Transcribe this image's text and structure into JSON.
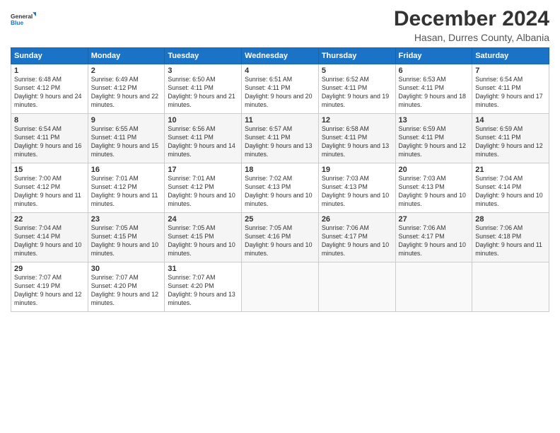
{
  "logo": {
    "line1": "General",
    "line2": "Blue"
  },
  "title": "December 2024",
  "subtitle": "Hasan, Durres County, Albania",
  "days_header": [
    "Sunday",
    "Monday",
    "Tuesday",
    "Wednesday",
    "Thursday",
    "Friday",
    "Saturday"
  ],
  "weeks": [
    [
      {
        "day": "1",
        "sunrise": "6:48 AM",
        "sunset": "4:12 PM",
        "daylight": "9 hours and 24 minutes."
      },
      {
        "day": "2",
        "sunrise": "6:49 AM",
        "sunset": "4:12 PM",
        "daylight": "9 hours and 22 minutes."
      },
      {
        "day": "3",
        "sunrise": "6:50 AM",
        "sunset": "4:11 PM",
        "daylight": "9 hours and 21 minutes."
      },
      {
        "day": "4",
        "sunrise": "6:51 AM",
        "sunset": "4:11 PM",
        "daylight": "9 hours and 20 minutes."
      },
      {
        "day": "5",
        "sunrise": "6:52 AM",
        "sunset": "4:11 PM",
        "daylight": "9 hours and 19 minutes."
      },
      {
        "day": "6",
        "sunrise": "6:53 AM",
        "sunset": "4:11 PM",
        "daylight": "9 hours and 18 minutes."
      },
      {
        "day": "7",
        "sunrise": "6:54 AM",
        "sunset": "4:11 PM",
        "daylight": "9 hours and 17 minutes."
      }
    ],
    [
      {
        "day": "8",
        "sunrise": "6:54 AM",
        "sunset": "4:11 PM",
        "daylight": "9 hours and 16 minutes."
      },
      {
        "day": "9",
        "sunrise": "6:55 AM",
        "sunset": "4:11 PM",
        "daylight": "9 hours and 15 minutes."
      },
      {
        "day": "10",
        "sunrise": "6:56 AM",
        "sunset": "4:11 PM",
        "daylight": "9 hours and 14 minutes."
      },
      {
        "day": "11",
        "sunrise": "6:57 AM",
        "sunset": "4:11 PM",
        "daylight": "9 hours and 13 minutes."
      },
      {
        "day": "12",
        "sunrise": "6:58 AM",
        "sunset": "4:11 PM",
        "daylight": "9 hours and 13 minutes."
      },
      {
        "day": "13",
        "sunrise": "6:59 AM",
        "sunset": "4:11 PM",
        "daylight": "9 hours and 12 minutes."
      },
      {
        "day": "14",
        "sunrise": "6:59 AM",
        "sunset": "4:11 PM",
        "daylight": "9 hours and 12 minutes."
      }
    ],
    [
      {
        "day": "15",
        "sunrise": "7:00 AM",
        "sunset": "4:12 PM",
        "daylight": "9 hours and 11 minutes."
      },
      {
        "day": "16",
        "sunrise": "7:01 AM",
        "sunset": "4:12 PM",
        "daylight": "9 hours and 11 minutes."
      },
      {
        "day": "17",
        "sunrise": "7:01 AM",
        "sunset": "4:12 PM",
        "daylight": "9 hours and 10 minutes."
      },
      {
        "day": "18",
        "sunrise": "7:02 AM",
        "sunset": "4:13 PM",
        "daylight": "9 hours and 10 minutes."
      },
      {
        "day": "19",
        "sunrise": "7:03 AM",
        "sunset": "4:13 PM",
        "daylight": "9 hours and 10 minutes."
      },
      {
        "day": "20",
        "sunrise": "7:03 AM",
        "sunset": "4:13 PM",
        "daylight": "9 hours and 10 minutes."
      },
      {
        "day": "21",
        "sunrise": "7:04 AM",
        "sunset": "4:14 PM",
        "daylight": "9 hours and 10 minutes."
      }
    ],
    [
      {
        "day": "22",
        "sunrise": "7:04 AM",
        "sunset": "4:14 PM",
        "daylight": "9 hours and 10 minutes."
      },
      {
        "day": "23",
        "sunrise": "7:05 AM",
        "sunset": "4:15 PM",
        "daylight": "9 hours and 10 minutes."
      },
      {
        "day": "24",
        "sunrise": "7:05 AM",
        "sunset": "4:15 PM",
        "daylight": "9 hours and 10 minutes."
      },
      {
        "day": "25",
        "sunrise": "7:05 AM",
        "sunset": "4:16 PM",
        "daylight": "9 hours and 10 minutes."
      },
      {
        "day": "26",
        "sunrise": "7:06 AM",
        "sunset": "4:17 PM",
        "daylight": "9 hours and 10 minutes."
      },
      {
        "day": "27",
        "sunrise": "7:06 AM",
        "sunset": "4:17 PM",
        "daylight": "9 hours and 10 minutes."
      },
      {
        "day": "28",
        "sunrise": "7:06 AM",
        "sunset": "4:18 PM",
        "daylight": "9 hours and 11 minutes."
      }
    ],
    [
      {
        "day": "29",
        "sunrise": "7:07 AM",
        "sunset": "4:19 PM",
        "daylight": "9 hours and 12 minutes."
      },
      {
        "day": "30",
        "sunrise": "7:07 AM",
        "sunset": "4:20 PM",
        "daylight": "9 hours and 12 minutes."
      },
      {
        "day": "31",
        "sunrise": "7:07 AM",
        "sunset": "4:20 PM",
        "daylight": "9 hours and 13 minutes."
      },
      null,
      null,
      null,
      null
    ]
  ]
}
